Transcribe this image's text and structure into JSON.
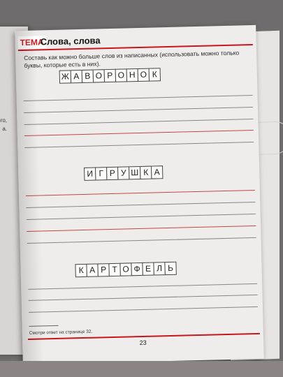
{
  "left_page": {
    "fragments": [
      "ого,",
      "а."
    ]
  },
  "header": {
    "badge": "ТЕМА",
    "title": "Слова, слова"
  },
  "instruction": "Составь как можно больше слов из написанных (использовать можно только буквы, которые есть в них).",
  "words": [
    {
      "letters": [
        "Ж",
        "А",
        "В",
        "О",
        "Р",
        "О",
        "Н",
        "О",
        "К"
      ]
    },
    {
      "letters": [
        "И",
        "Г",
        "Р",
        "У",
        "Ш",
        "К",
        "А"
      ]
    },
    {
      "letters": [
        "К",
        "А",
        "Р",
        "Т",
        "О",
        "Ф",
        "Е",
        "Л",
        "Ь"
      ]
    }
  ],
  "footnote": "Смотри ответ на странице 32.",
  "page_number": "23",
  "colors": {
    "accent": "#c8161d",
    "page": "#efedeb",
    "background": "#6f6c6d"
  }
}
